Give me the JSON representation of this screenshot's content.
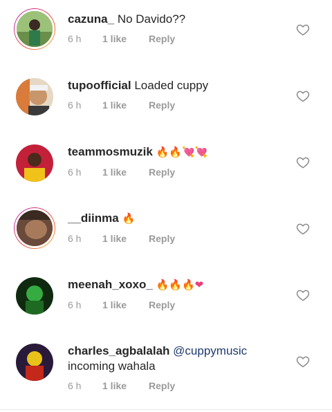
{
  "comments": [
    {
      "username": "cazuna_",
      "text": "No Davido??",
      "time": "6 h",
      "likes": "1 like",
      "reply": "Reply",
      "emojis": []
    },
    {
      "username": "tupoofficial",
      "text": "Loaded cuppy",
      "time": "6 h",
      "likes": "1 like",
      "reply": "Reply",
      "emojis": []
    },
    {
      "username": "teammosmuzik",
      "text": "",
      "time": "6 h",
      "likes": "1 like",
      "reply": "Reply",
      "emojis": [
        "🔥",
        "🔥",
        "💘",
        "💘"
      ]
    },
    {
      "username": "__diinma",
      "text": "",
      "time": "6 h",
      "likes": "1 like",
      "reply": "Reply",
      "emojis": [
        "🔥"
      ]
    },
    {
      "username": "meenah_xoxo_",
      "text": "",
      "time": "6 h",
      "likes": "1 like",
      "reply": "Reply",
      "emojis": [
        "🔥",
        "🔥",
        "🔥",
        "❤"
      ]
    },
    {
      "username": "charles_agbalalah",
      "mention": "@cuppymusic",
      "text": "incoming wahala",
      "time": "6 h",
      "likes": "1 like",
      "reply": "Reply",
      "emojis": []
    }
  ],
  "icons": {
    "like": "heart-outline-icon"
  },
  "colors": {
    "username": "#262626",
    "meta": "#9a9a9a",
    "mention": "#1e3a6e",
    "story_ring_start": "#d8287d",
    "story_ring_end": "#f8a23a"
  }
}
